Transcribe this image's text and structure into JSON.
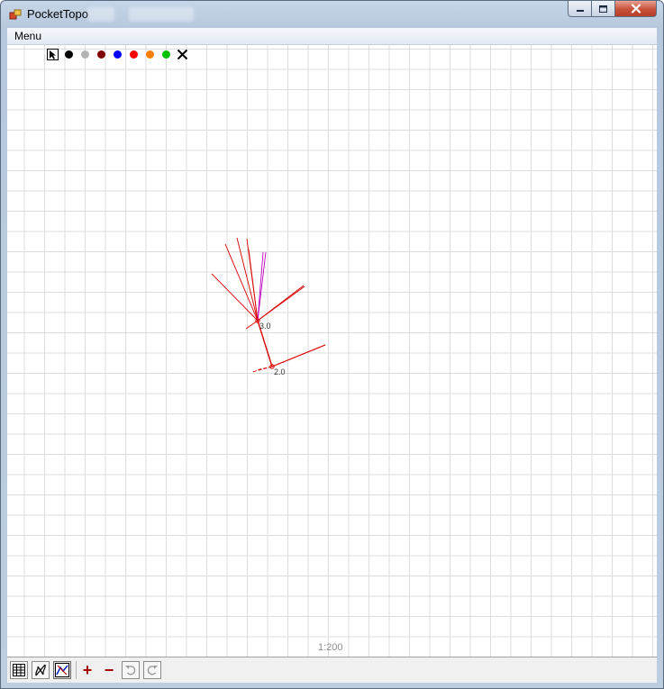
{
  "window": {
    "title": "PocketTopo"
  },
  "menu": {
    "label": "Menu"
  },
  "palette": [
    {
      "name": "select-tool",
      "icon": "pointer-icon"
    },
    {
      "name": "color-black",
      "color": "#000000"
    },
    {
      "name": "color-gray",
      "color": "#b4b4b4"
    },
    {
      "name": "color-brown",
      "color": "#800000"
    },
    {
      "name": "color-blue",
      "color": "#0000ff"
    },
    {
      "name": "color-red",
      "color": "#ff0000"
    },
    {
      "name": "color-orange",
      "color": "#ff8000"
    },
    {
      "name": "color-green",
      "color": "#00c000"
    },
    {
      "name": "erase-tool",
      "icon": "x-icon"
    }
  ],
  "survey": {
    "stations": [
      {
        "label": "3.0"
      },
      {
        "label": "2.0"
      }
    ],
    "line_color": "#dd0000",
    "splay_color": "#c000c0"
  },
  "status": {
    "scale": "1:200"
  },
  "toolbar": {
    "buttons": [
      "data-table-icon",
      "map-view-icon",
      "sketch-view-icon",
      "zoom-in-icon",
      "zoom-out-icon",
      "undo-icon",
      "redo-icon"
    ],
    "plus_label": "+",
    "minus_label": "−"
  }
}
